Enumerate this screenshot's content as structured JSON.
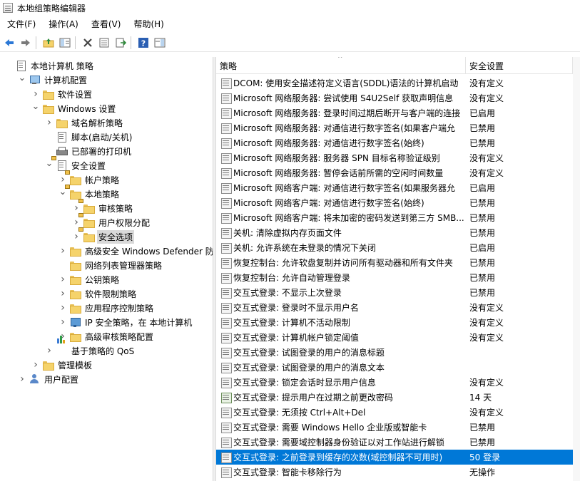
{
  "window": {
    "title": "本地组策略编辑器"
  },
  "menu": [
    "文件(F)",
    "操作(A)",
    "查看(V)",
    "帮助(H)"
  ],
  "toolbar": [
    "back-icon",
    "forward-icon",
    "up-folder-icon",
    "show-hide-tree-icon",
    "delete-icon",
    "properties-icon",
    "export-list-icon",
    "help-icon",
    "show-pane-icon"
  ],
  "tree": [
    {
      "label": "本地计算机 策略",
      "indent": 0,
      "twisty": "",
      "icon": "doc"
    },
    {
      "label": "计算机配置",
      "indent": 1,
      "twisty": "v",
      "icon": "computer"
    },
    {
      "label": "软件设置",
      "indent": 2,
      "twisty": ">",
      "icon": "folder"
    },
    {
      "label": "Windows 设置",
      "indent": 2,
      "twisty": "v",
      "icon": "folder"
    },
    {
      "label": "域名解析策略",
      "indent": 3,
      "twisty": ">",
      "icon": "folder"
    },
    {
      "label": "脚本(启动/关机)",
      "indent": 3,
      "twisty": "",
      "icon": "doc"
    },
    {
      "label": "已部署的打印机",
      "indent": 3,
      "twisty": "",
      "icon": "printer"
    },
    {
      "label": "安全设置",
      "indent": 3,
      "twisty": "v",
      "icon": "lockdoc"
    },
    {
      "label": "帐户策略",
      "indent": 4,
      "twisty": ">",
      "icon": "lockfolder"
    },
    {
      "label": "本地策略",
      "indent": 4,
      "twisty": "v",
      "icon": "lockfolder"
    },
    {
      "label": "审核策略",
      "indent": 5,
      "twisty": ">",
      "icon": "lockfolder"
    },
    {
      "label": "用户权限分配",
      "indent": 5,
      "twisty": ">",
      "icon": "lockfolder"
    },
    {
      "label": "安全选项",
      "indent": 5,
      "twisty": ">",
      "icon": "lockfolder",
      "selected": true
    },
    {
      "label": "高级安全 Windows Defender 防火",
      "indent": 4,
      "twisty": ">",
      "icon": "folder"
    },
    {
      "label": "网络列表管理器策略",
      "indent": 4,
      "twisty": "",
      "icon": "folder"
    },
    {
      "label": "公钥策略",
      "indent": 4,
      "twisty": ">",
      "icon": "folder"
    },
    {
      "label": "软件限制策略",
      "indent": 4,
      "twisty": ">",
      "icon": "folder"
    },
    {
      "label": "应用程序控制策略",
      "indent": 4,
      "twisty": ">",
      "icon": "folder"
    },
    {
      "label": "IP 安全策略，在 本地计算机",
      "indent": 4,
      "twisty": ">",
      "icon": "shieldnet"
    },
    {
      "label": "高级审核策略配置",
      "indent": 4,
      "twisty": ">",
      "icon": "folder"
    },
    {
      "label": "基于策略的 QoS",
      "indent": 3,
      "twisty": ">",
      "icon": "barchart"
    },
    {
      "label": "管理模板",
      "indent": 2,
      "twisty": ">",
      "icon": "folder"
    },
    {
      "label": "用户配置",
      "indent": 1,
      "twisty": ">",
      "icon": "user"
    }
  ],
  "list": {
    "columns": {
      "policy": "策略",
      "setting": "安全设置"
    },
    "rows": [
      {
        "name": "DCOM: 使用安全描述符定义语言(SDDL)语法的计算机启动",
        "setting": "没有定义"
      },
      {
        "name": "Microsoft 网络服务器: 尝试使用 S4U2Self 获取声明信息",
        "setting": "没有定义"
      },
      {
        "name": "Microsoft 网络服务器: 登录时间过期后断开与客户端的连接",
        "setting": "已启用"
      },
      {
        "name": "Microsoft 网络服务器: 对通信进行数字签名(如果客户端允",
        "setting": "已禁用"
      },
      {
        "name": "Microsoft 网络服务器: 对通信进行数字签名(始终)",
        "setting": "已禁用"
      },
      {
        "name": "Microsoft 网络服务器: 服务器 SPN 目标名称验证级别",
        "setting": "没有定义"
      },
      {
        "name": "Microsoft 网络服务器: 暂停会话前所需的空闲时间数量",
        "setting": "没有定义"
      },
      {
        "name": "Microsoft 网络客户端: 对通信进行数字签名(如果服务器允",
        "setting": "已启用"
      },
      {
        "name": "Microsoft 网络客户端: 对通信进行数字签名(始终)",
        "setting": "已禁用"
      },
      {
        "name": "Microsoft 网络客户端: 将未加密的密码发送到第三方 SMB...",
        "setting": "已禁用"
      },
      {
        "name": "关机: 清除虚拟内存页面文件",
        "setting": "已禁用"
      },
      {
        "name": "关机: 允许系统在未登录的情况下关闭",
        "setting": "已启用"
      },
      {
        "name": "恢复控制台: 允许软盘复制并访问所有驱动器和所有文件夹",
        "setting": "已禁用"
      },
      {
        "name": "恢复控制台: 允许自动管理登录",
        "setting": "已禁用"
      },
      {
        "name": "交互式登录: 不显示上次登录",
        "setting": "已禁用"
      },
      {
        "name": "交互式登录: 登录时不显示用户名",
        "setting": "没有定义"
      },
      {
        "name": "交互式登录: 计算机不活动限制",
        "setting": "没有定义"
      },
      {
        "name": "交互式登录: 计算机帐户锁定阈值",
        "setting": "没有定义"
      },
      {
        "name": "交互式登录: 试图登录的用户的消息标题",
        "setting": ""
      },
      {
        "name": "交互式登录: 试图登录的用户的消息文本",
        "setting": ""
      },
      {
        "name": "交互式登录: 锁定会话时显示用户信息",
        "setting": "没有定义"
      },
      {
        "name": "交互式登录: 提示用户在过期之前更改密码",
        "setting": "14 天",
        "alt": true
      },
      {
        "name": "交互式登录: 无须按 Ctrl+Alt+Del",
        "setting": "没有定义"
      },
      {
        "name": "交互式登录: 需要 Windows Hello 企业版或智能卡",
        "setting": "已禁用"
      },
      {
        "name": "交互式登录: 需要域控制器身份验证以对工作站进行解锁",
        "setting": "已禁用"
      },
      {
        "name": "交互式登录: 之前登录到缓存的次数(域控制器不可用时)",
        "setting": "50 登录",
        "selected": true
      },
      {
        "name": "交互式登录: 智能卡移除行为",
        "setting": "无操作"
      }
    ]
  }
}
